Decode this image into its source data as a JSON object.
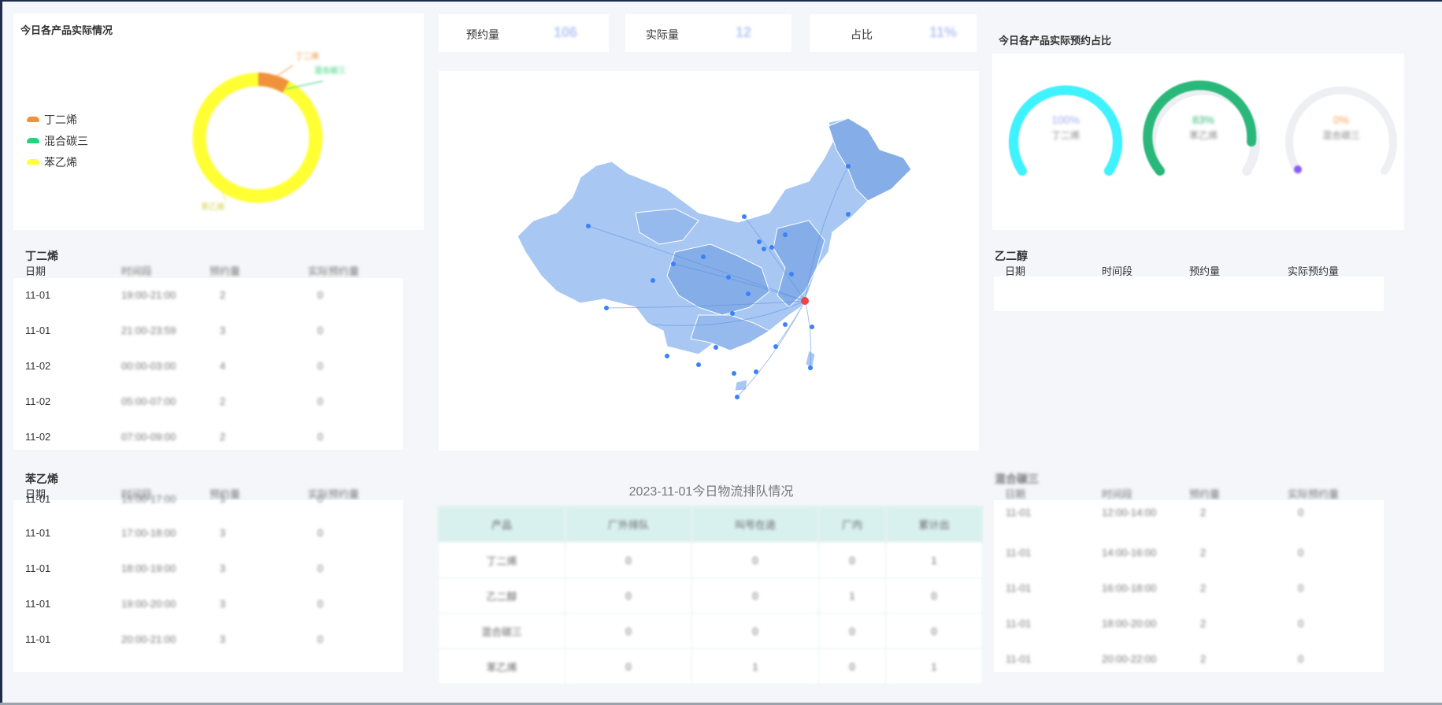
{
  "donut_panel": {
    "title": "今日各产品实际情况",
    "legend": [
      {
        "name": "丁二烯",
        "color": "#f0923b"
      },
      {
        "name": "混合碳三",
        "color": "#2bd07a"
      },
      {
        "name": "苯乙烯",
        "color": "#ffff33"
      }
    ],
    "labels": {
      "a": "丁二烯",
      "b": "混合碳三",
      "c": "苯乙烯"
    }
  },
  "stats": {
    "reserved_label": "预约量",
    "reserved_value": "106",
    "actual_label": "实际量",
    "actual_value": "12",
    "ratio_label": "占比",
    "ratio_value": "11%"
  },
  "gauge_panel": {
    "title": "今日各产品实际预约占比",
    "gauges": [
      {
        "percent": "100%",
        "name": "丁二烯",
        "color": "#3ef2ff",
        "value": 100
      },
      {
        "percent": "83%",
        "name": "苯乙烯",
        "color": "#2ab77a",
        "value": 83
      },
      {
        "percent": "0%",
        "name": "混合碳三",
        "color": "#f5a04c",
        "value": 0
      }
    ]
  },
  "table_butadiene": {
    "name": "丁二烯",
    "headers": [
      "日期",
      "时间段",
      "预约量",
      "实际预约量"
    ],
    "rows": [
      [
        "11-01",
        "19:00-21:00",
        "2",
        "0"
      ],
      [
        "11-01",
        "21:00-23:59",
        "3",
        "0"
      ],
      [
        "11-02",
        "00:00-03:00",
        "4",
        "0"
      ],
      [
        "11-02",
        "05:00-07:00",
        "2",
        "0"
      ],
      [
        "11-02",
        "07:00-09:00",
        "2",
        "0"
      ]
    ]
  },
  "table_styrene": {
    "name": "苯乙烯",
    "headers": [
      "日期",
      "时间段",
      "预约量",
      "实际预约量"
    ],
    "rows": [
      [
        "11-01",
        "15:00-17:00",
        "3",
        "0"
      ],
      [
        "11-01",
        "17:00-18:00",
        "3",
        "0"
      ],
      [
        "11-01",
        "18:00-19:00",
        "3",
        "0"
      ],
      [
        "11-01",
        "19:00-20:00",
        "3",
        "0"
      ],
      [
        "11-01",
        "20:00-21:00",
        "3",
        "0"
      ]
    ]
  },
  "table_glycol": {
    "name": "乙二醇",
    "headers": [
      "日期",
      "时间段",
      "预约量",
      "实际预约量"
    ]
  },
  "table_c3": {
    "name": "混合碳三",
    "headers": [
      "日期",
      "时间段",
      "预约量",
      "实际预约量"
    ],
    "rows": [
      [
        "11-01",
        "12:00-14:00",
        "2",
        "0"
      ],
      [
        "11-01",
        "14:00-16:00",
        "2",
        "0"
      ],
      [
        "11-01",
        "16:00-18:00",
        "2",
        "0"
      ],
      [
        "11-01",
        "18:00-20:00",
        "2",
        "0"
      ],
      [
        "11-01",
        "20:00-22:00",
        "2",
        "0"
      ]
    ]
  },
  "queue": {
    "title": "2023-11-01今日物流排队情况",
    "headers": [
      "产品",
      "厂外排队",
      "叫号在途",
      "厂内",
      "累计出"
    ],
    "rows": [
      [
        "丁二烯",
        "0",
        "0",
        "0",
        "1"
      ],
      [
        "乙二醇",
        "0",
        "0",
        "1",
        "0"
      ],
      [
        "混合碳三",
        "0",
        "0",
        "0",
        "0"
      ],
      [
        "苯乙烯",
        "0",
        "1",
        "0",
        "1"
      ]
    ]
  },
  "colors": {
    "accent": "#3b82f6",
    "map_dark": "#85aee8",
    "map_light": "#a8c8f3",
    "table_head": "#d8f0ee"
  }
}
